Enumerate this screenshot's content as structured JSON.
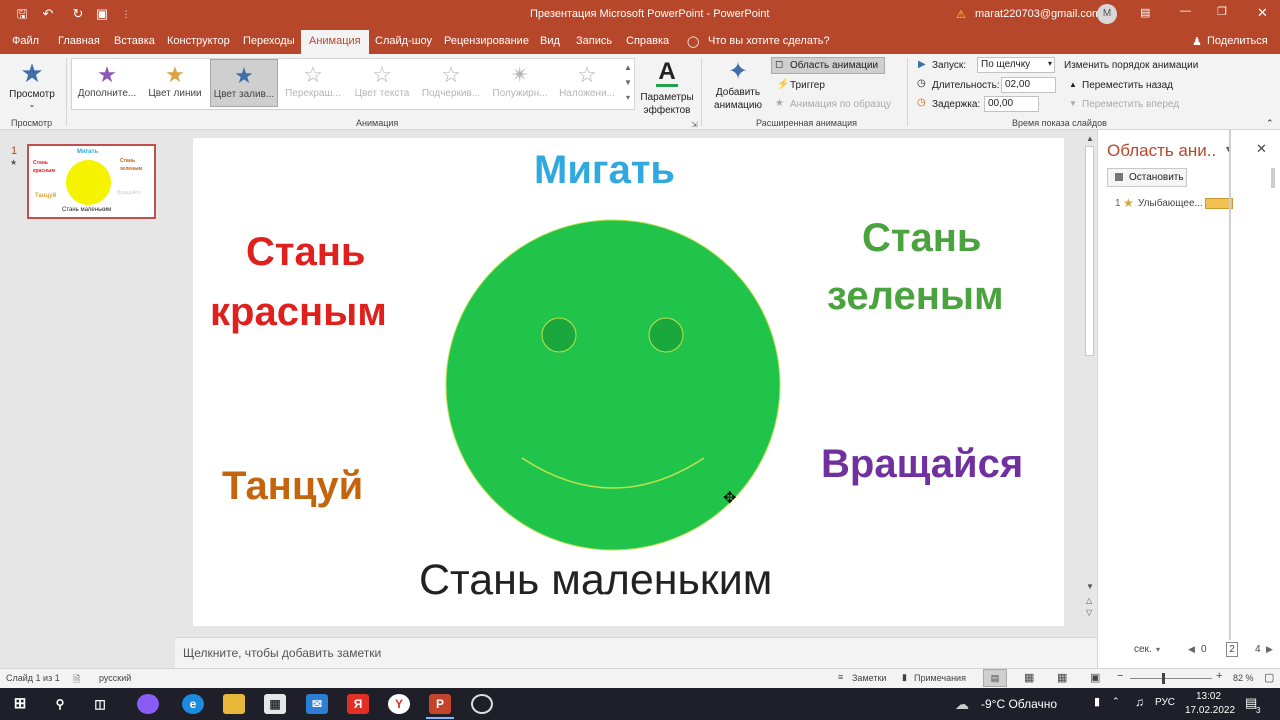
{
  "window": {
    "title": "Презентация Microsoft PowerPoint  -  PowerPoint",
    "account": "marat220703@gmail.com",
    "avatar": "M"
  },
  "quick_access": [
    "save-icon",
    "undo-icon",
    "redo-icon",
    "present-icon"
  ],
  "menu": {
    "items": [
      "Файл",
      "Главная",
      "Вставка",
      "Конструктор",
      "Переходы",
      "Анимация",
      "Слайд-шоу",
      "Рецензирование",
      "Вид",
      "Запись",
      "Справка"
    ],
    "active": "Анимация",
    "search": "Что вы хотите сделать?",
    "share": "Поделиться"
  },
  "ribbon": {
    "preview": {
      "label": "Просмотр",
      "group": "Просмотр"
    },
    "gallery": [
      {
        "label": "Дополните...",
        "icon": "star-multicolor-icon",
        "color": "#8e59b3",
        "state": "normal"
      },
      {
        "label": "Цвет линии",
        "icon": "star-gold-icon",
        "color": "#d9a441",
        "state": "normal"
      },
      {
        "label": "Цвет залив...",
        "icon": "star-blue-icon",
        "color": "#3f6ea8",
        "state": "selected"
      },
      {
        "label": "Перекраш...",
        "icon": "letter-a-star-icon",
        "color": "#c4c4c4",
        "state": "disabled"
      },
      {
        "label": "Цвет текста",
        "icon": "letter-a-star-icon",
        "color": "#c4c4c4",
        "state": "disabled"
      },
      {
        "label": "Подчеркив...",
        "icon": "letter-u-star-icon",
        "color": "#c4c4c4",
        "state": "disabled"
      },
      {
        "label": "Полужирн...",
        "icon": "letter-zh-star-icon",
        "color": "#c4c4c4",
        "state": "disabled"
      },
      {
        "label": "Наложени...",
        "icon": "letter-a-star-icon",
        "color": "#c4c4c4",
        "state": "disabled"
      }
    ],
    "effect_options": "Параметры эффектов",
    "animation_group": "Анимация",
    "add_animation": "Добавить анимацию",
    "animation_pane_btn": "Область анимации",
    "trigger": "Триггер",
    "painter": "Анимация по образцу",
    "advanced_group": "Расширенная анимация",
    "start_label": "Запуск:",
    "start_value": "По щелчку",
    "duration_label": "Длительность:",
    "duration_value": "02,00",
    "delay_label": "Задержка:",
    "delay_value": "00,00",
    "reorder_title": "Изменить порядок анимации",
    "move_earlier": "Переместить назад",
    "move_later": "Переместить вперед",
    "timing_group": "Время показа слайдов"
  },
  "thumbnail": {
    "number": "1",
    "star": "★"
  },
  "slide": {
    "texts": {
      "blink": "Мигать",
      "red_line1": "Стань",
      "red_line2": "красным",
      "green_line1": "Стань",
      "green_line2": "зеленым",
      "dance": "Танцуй",
      "rotate": "Вращайся",
      "small": "Стань маленьким"
    },
    "colors": {
      "blink": "#2fa9e0",
      "red": "#e0201c",
      "green": "#4aa33e",
      "dance": "#c4650d",
      "rotate": "#7030a0",
      "face": "#21c44a"
    }
  },
  "thumb_texts": {
    "blink": "Мигать",
    "red": "Стань красным",
    "green": "Стань зеленым",
    "dance": "Танцуй",
    "rotate": "Вращайся",
    "small": "Стань маленьким"
  },
  "notes": {
    "placeholder": "Щелкните, чтобы добавить заметки"
  },
  "pane": {
    "title": "Область ани..",
    "stop": "Остановить",
    "item_num": "1",
    "item_label": "Улыбающее...",
    "units": "сек.",
    "ticks": [
      "0",
      "2",
      "4"
    ]
  },
  "status": {
    "slide": "Слайд 1 из 1",
    "language": "русский",
    "notes": "Заметки",
    "comments": "Примечания",
    "zoom": "82 %"
  },
  "taskbar": {
    "weather": "-9°C  Облачно",
    "lang": "РУС",
    "time": "13:02",
    "date": "17.02.2022",
    "notif": "3"
  }
}
